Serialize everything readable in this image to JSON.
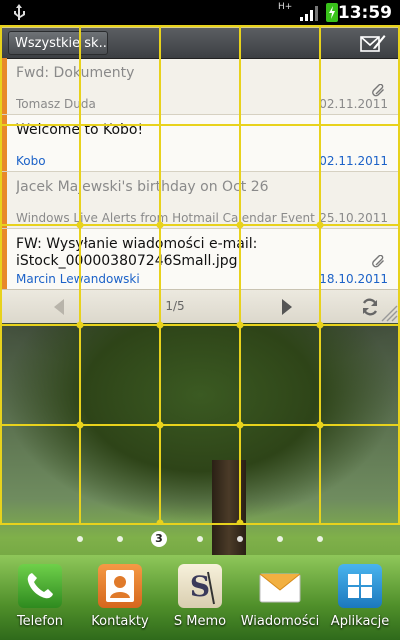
{
  "status_bar": {
    "network": "H+",
    "time": "13:59"
  },
  "email_widget": {
    "folder": "Wszystkie sk...",
    "messages": [
      {
        "subject": "Fwd: Dokumenty",
        "sender": "Tomasz Duda",
        "date": "02.11.2011",
        "read": true,
        "attachment": true
      },
      {
        "subject": "Welcome to Kobo!",
        "sender": "Kobo",
        "date": "02.11.2011",
        "read": false,
        "attachment": false
      },
      {
        "subject": "Jacek Majewski's birthday on Oct 26",
        "sender": "Windows Live Alerts from Hotmail Calendar Event Remi",
        "date": "25.10.2011",
        "read": true,
        "attachment": false
      },
      {
        "subject": "FW: Wysyłanie wiadomości e-mail: iStock_000003807246Small.jpg",
        "sender": "Marcin Lewandowski",
        "date": "18.10.2011",
        "read": false,
        "attachment": true
      }
    ],
    "page_indicator": "1/5"
  },
  "home_screen": {
    "current_page": "3"
  },
  "dock": {
    "apps": [
      {
        "label": "Telefon",
        "icon": "phone-icon",
        "color": "#3aa12b"
      },
      {
        "label": "Kontakty",
        "icon": "contacts-icon",
        "color": "#e8782a"
      },
      {
        "label": "S Memo",
        "icon": "s-memo-icon",
        "color": "#efe6c8"
      },
      {
        "label": "Wiadomości",
        "icon": "messages-icon",
        "color": "#f0a83a"
      },
      {
        "label": "Aplikacje",
        "icon": "apps-grid-icon",
        "color": "#2a8fd0"
      }
    ]
  },
  "colors": {
    "grid_line": "#e8d21c",
    "unread_accent": "#e8892a",
    "link_blue": "#1c62c8"
  }
}
